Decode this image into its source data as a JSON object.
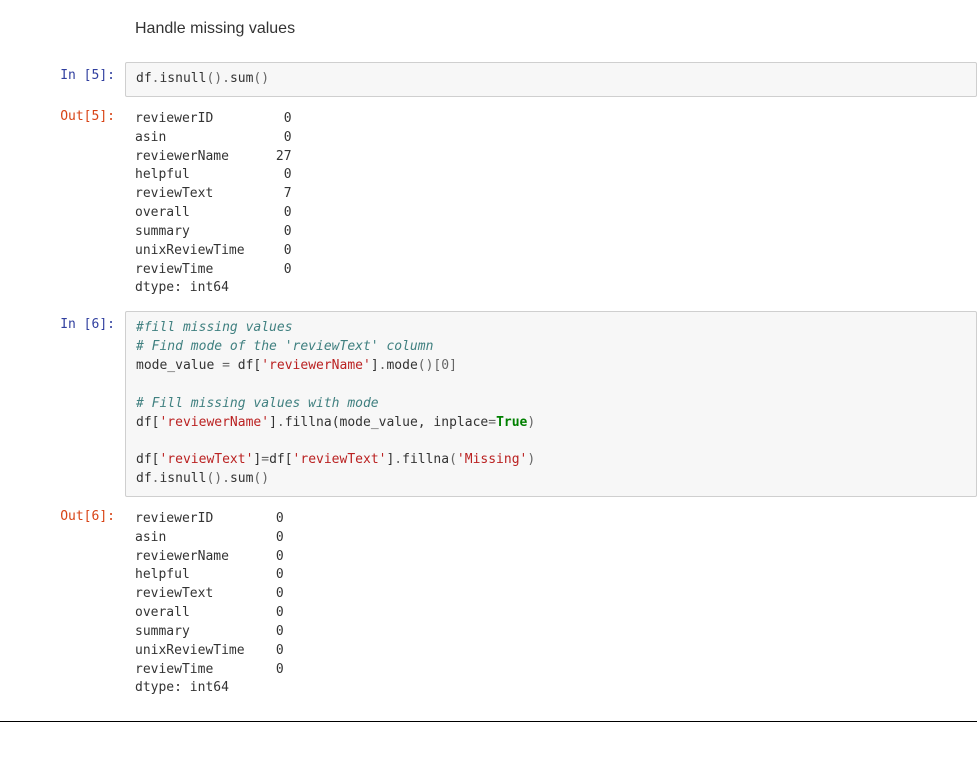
{
  "heading": "Handle missing values",
  "cells": [
    {
      "type": "code",
      "prompt": "In [5]:",
      "lines": [
        [
          {
            "t": "df",
            "cls": "c-id"
          },
          {
            "t": ".",
            "cls": "c-op"
          },
          {
            "t": "isnull",
            "cls": "c-call"
          },
          {
            "t": "().",
            "cls": "c-op"
          },
          {
            "t": "sum",
            "cls": "c-call"
          },
          {
            "t": "()",
            "cls": "c-op"
          }
        ]
      ]
    },
    {
      "type": "output",
      "prompt": "Out[5]:",
      "lines": [
        "reviewerID         0",
        "asin               0",
        "reviewerName      27",
        "helpful            0",
        "reviewText         7",
        "overall            0",
        "summary            0",
        "unixReviewTime     0",
        "reviewTime         0",
        "dtype: int64"
      ]
    },
    {
      "type": "code",
      "prompt": "In [6]:",
      "lines": [
        [
          {
            "t": "#fill missing values",
            "cls": "c-comment"
          }
        ],
        [
          {
            "t": "# Find mode of the 'reviewText' column",
            "cls": "c-comment"
          }
        ],
        [
          {
            "t": "mode_value ",
            "cls": "c-id"
          },
          {
            "t": "=",
            "cls": "c-op"
          },
          {
            "t": " df[",
            "cls": "c-id"
          },
          {
            "t": "'reviewerName'",
            "cls": "c-str"
          },
          {
            "t": "]",
            "cls": "c-id"
          },
          {
            "t": ".",
            "cls": "c-op"
          },
          {
            "t": "mode",
            "cls": "c-call"
          },
          {
            "t": "()[",
            "cls": "c-op"
          },
          {
            "t": "0",
            "cls": "c-num"
          },
          {
            "t": "]",
            "cls": "c-op"
          }
        ],
        [
          {
            "t": "",
            "cls": ""
          }
        ],
        [
          {
            "t": "# Fill missing values with mode",
            "cls": "c-comment"
          }
        ],
        [
          {
            "t": "df[",
            "cls": "c-id"
          },
          {
            "t": "'reviewerName'",
            "cls": "c-str"
          },
          {
            "t": "]",
            "cls": "c-id"
          },
          {
            "t": ".",
            "cls": "c-op"
          },
          {
            "t": "fillna",
            "cls": "c-call"
          },
          {
            "t": "(mode_value, inplace",
            "cls": "c-id"
          },
          {
            "t": "=",
            "cls": "c-op"
          },
          {
            "t": "True",
            "cls": "c-kw"
          },
          {
            "t": ")",
            "cls": "c-op"
          }
        ],
        [
          {
            "t": "",
            "cls": ""
          }
        ],
        [
          {
            "t": "df[",
            "cls": "c-id"
          },
          {
            "t": "'reviewText'",
            "cls": "c-str"
          },
          {
            "t": "]",
            "cls": "c-id"
          },
          {
            "t": "=",
            "cls": "c-op"
          },
          {
            "t": "df[",
            "cls": "c-id"
          },
          {
            "t": "'reviewText'",
            "cls": "c-str"
          },
          {
            "t": "]",
            "cls": "c-id"
          },
          {
            "t": ".",
            "cls": "c-op"
          },
          {
            "t": "fillna",
            "cls": "c-call"
          },
          {
            "t": "(",
            "cls": "c-op"
          },
          {
            "t": "'Missing'",
            "cls": "c-str"
          },
          {
            "t": ")",
            "cls": "c-op"
          }
        ],
        [
          {
            "t": "df",
            "cls": "c-id"
          },
          {
            "t": ".",
            "cls": "c-op"
          },
          {
            "t": "isnull",
            "cls": "c-call"
          },
          {
            "t": "().",
            "cls": "c-op"
          },
          {
            "t": "sum",
            "cls": "c-call"
          },
          {
            "t": "()",
            "cls": "c-op"
          }
        ]
      ]
    },
    {
      "type": "output",
      "prompt": "Out[6]:",
      "lines": [
        "reviewerID        0",
        "asin              0",
        "reviewerName      0",
        "helpful           0",
        "reviewText        0",
        "overall           0",
        "summary           0",
        "unixReviewTime    0",
        "reviewTime        0",
        "dtype: int64"
      ]
    }
  ]
}
